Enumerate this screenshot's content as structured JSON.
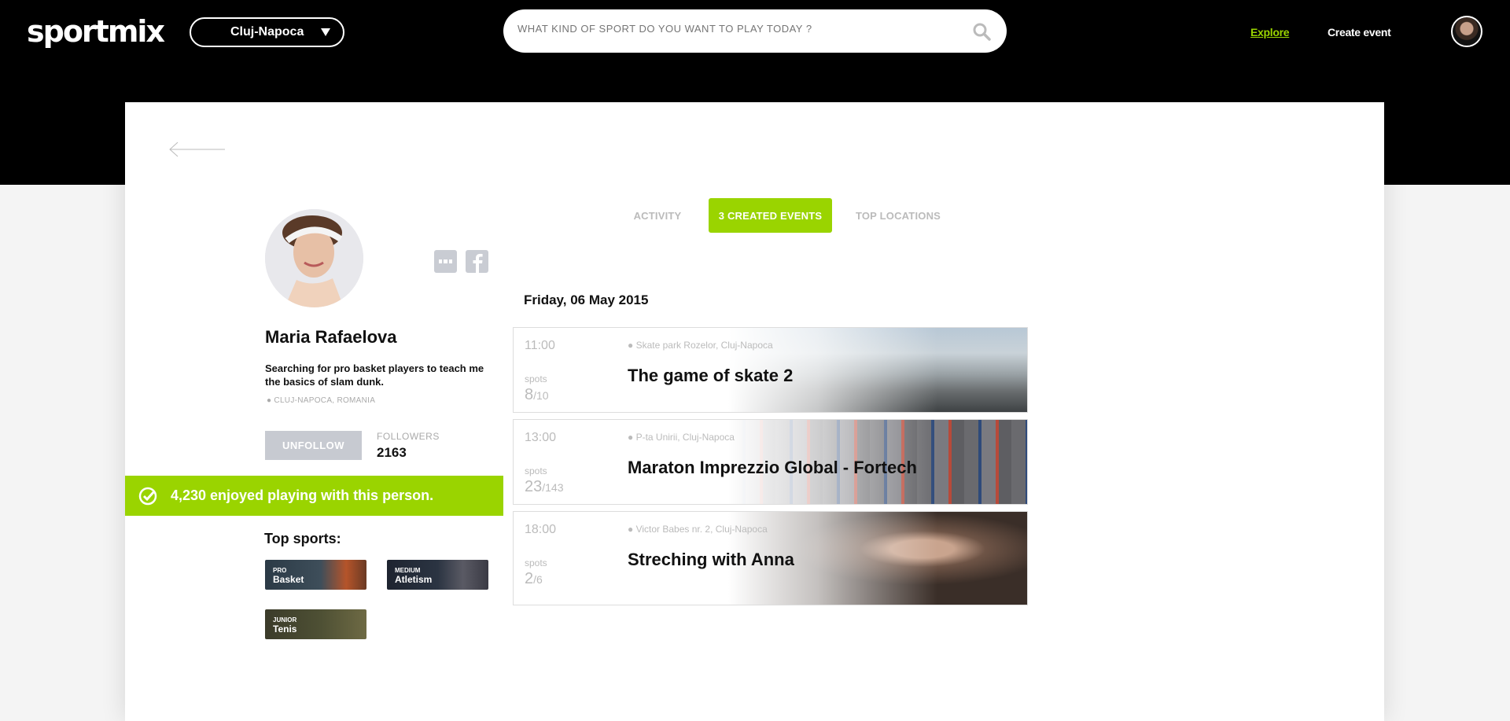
{
  "header": {
    "logo": "sportmix",
    "city": "Cluj-Napoca",
    "search_placeholder": "WHAT KIND OF SPORT DO YOU WANT TO PLAY TODAY ?",
    "nav_explore": "Explore",
    "nav_create": "Create event",
    "accent_color": "#9ad400"
  },
  "profile": {
    "name": "Maria Rafaelova",
    "bio": "Searching for pro basket  players to teach me the basics of slam dunk.",
    "location": "● CLUJ-NAPOCA, ROMANIA",
    "unfollow_label": "UNFOLLOW",
    "followers_label": "FOLLOWERS",
    "followers_count": "2163",
    "enjoy_text": "4,230 enjoyed playing with this person.",
    "top_sports_title": "Top sports:",
    "sports": [
      {
        "level": "PRO",
        "name": "Basket"
      },
      {
        "level": "MEDIUM",
        "name": "Atletism"
      },
      {
        "level": "JUNIOR",
        "name": "Tenis"
      }
    ]
  },
  "tabs": {
    "activity": "ACTIVITY",
    "created": "3 CREATED EVENTS",
    "top_locations": "TOP LOCATIONS"
  },
  "events_date": "Friday, 06 May 2015",
  "events": [
    {
      "time": "11:00",
      "spots_label": "spots",
      "spots_taken": "8",
      "spots_total": "/10",
      "place": "● Skate park Rozelor, Cluj-Napoca",
      "title": "The game of skate 2"
    },
    {
      "time": "13:00",
      "spots_label": "spots",
      "spots_taken": "23",
      "spots_total": "/143",
      "place": "● P-ta Unirii, Cluj-Napoca",
      "title": "Maraton Imprezzio Global - Fortech"
    },
    {
      "time": "18:00",
      "spots_label": "spots",
      "spots_taken": "2",
      "spots_total": "/6",
      "place": "● Victor Babes nr. 2, Cluj-Napoca",
      "title": "Streching with Anna"
    }
  ]
}
